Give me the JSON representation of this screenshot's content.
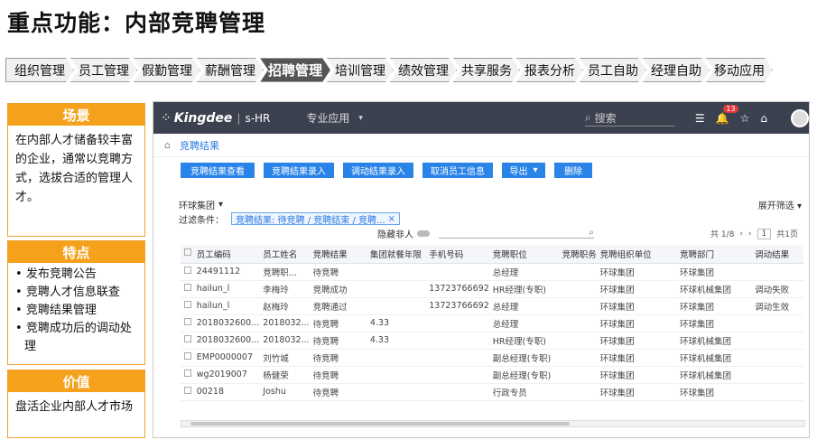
{
  "slide_title": "重点功能：内部竞聘管理",
  "nav": [
    {
      "label": "组织管理",
      "active": false
    },
    {
      "label": "员工管理",
      "active": false
    },
    {
      "label": "假勤管理",
      "active": false
    },
    {
      "label": "薪酬管理",
      "active": false
    },
    {
      "label": "招聘管理",
      "active": true
    },
    {
      "label": "培训管理",
      "active": false
    },
    {
      "label": "绩效管理",
      "active": false
    },
    {
      "label": "共享服务",
      "active": false
    },
    {
      "label": "报表分析",
      "active": false
    },
    {
      "label": "员工自助",
      "active": false
    },
    {
      "label": "经理自助",
      "active": false
    },
    {
      "label": "移动应用",
      "active": false
    }
  ],
  "cards": {
    "scene": {
      "head": "场景",
      "body": "在内部人才储备较丰富的企业，通常以竞聘方式，选拔合适的管理人才。"
    },
    "features": {
      "head": "特点",
      "items": [
        "发布竞聘公告",
        "竞聘人才信息联查",
        "竞聘结果管理",
        "竞聘成功后的调动处理"
      ]
    },
    "value": {
      "head": "价值",
      "body": "盘活企业内部人才市场"
    }
  },
  "app": {
    "brand": "Kingdee",
    "product": "s-HR",
    "menu": "专业应用",
    "search_placeholder": "搜索",
    "badge_count": "13",
    "breadcrumb": "竞聘结果",
    "buttons": [
      "竞聘结果查看",
      "竞聘结果录入",
      "调动结果录入",
      "取消员工信息",
      "导出",
      "删除"
    ],
    "filter_scheme": "环球集团",
    "filter_label": "过滤条件：",
    "filter_chip": "竞聘结果: 待竞聘 / 竞聘结束 / 竞聘...",
    "toggle_label": "隐藏非人",
    "expand_label": "展开筛选",
    "pager_text": "共 1/8",
    "page_num": "1",
    "page_total": "共1页",
    "columns": [
      "员工编码",
      "员工姓名",
      "竞聘结果",
      "集团就餐年限",
      "手机号码",
      "竞聘职位",
      "竞聘职务",
      "竞聘组织单位",
      "竞聘部门",
      "调动结果"
    ],
    "rows": [
      [
        "24491112",
        "竞聘职...",
        "待竞聘",
        "",
        "",
        "总经理",
        "",
        "环球集团",
        "环球集团",
        ""
      ],
      [
        "hailun_l",
        "李梅玲",
        "竞聘成功",
        "",
        "13723766692",
        "HR经理(专职)",
        "",
        "环球集团",
        "环球机械集团",
        "调动失败"
      ],
      [
        "hailun_l",
        "赵梅玲",
        "竞聘通过",
        "",
        "13723766692",
        "总经理",
        "",
        "环球集团",
        "环球集团",
        "调动生效"
      ],
      [
        "2018032600...",
        "2018032...",
        "待竞聘",
        "4.33",
        "",
        "总经理",
        "",
        "环球集团",
        "环球集团",
        ""
      ],
      [
        "2018032600...",
        "2018032...",
        "待竞聘",
        "4.33",
        "",
        "HR经理(专职)",
        "",
        "环球集团",
        "环球机械集团",
        ""
      ],
      [
        "EMP0000007",
        "刘竹城",
        "待竞聘",
        "",
        "",
        "副总经理(专职)",
        "",
        "环球集团",
        "环球机械集团",
        ""
      ],
      [
        "wg2019007",
        "杨健荣",
        "待竞聘",
        "",
        "",
        "副总经理(专职)",
        "",
        "环球集团",
        "环球机械集团",
        ""
      ],
      [
        "00218",
        "Joshu",
        "待竞聘",
        "",
        "",
        "行政专员",
        "",
        "环球集团",
        "环球集团",
        ""
      ]
    ]
  }
}
